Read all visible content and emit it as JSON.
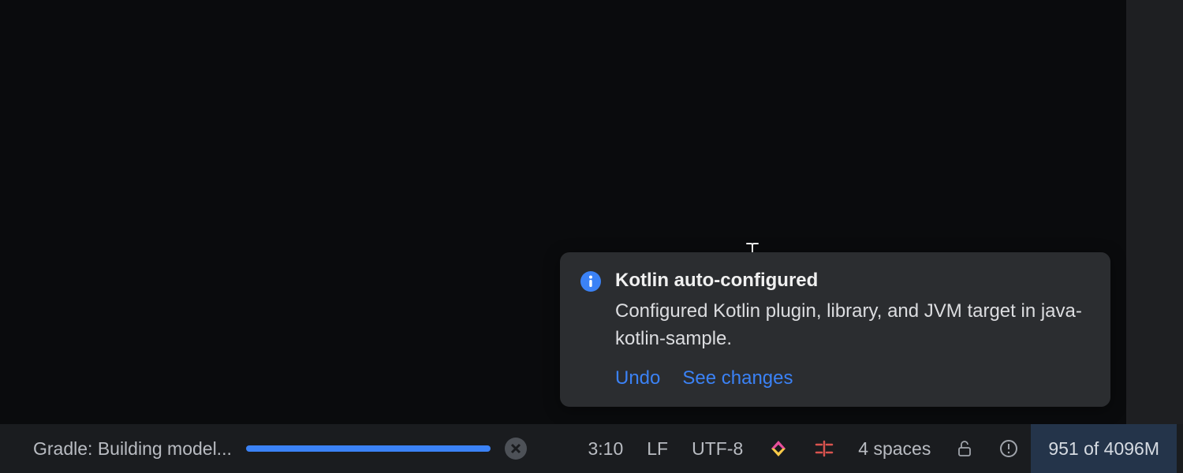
{
  "notification": {
    "icon": "info-icon",
    "title": "Kotlin auto-configured",
    "message": "Configured Kotlin plugin, library, and JVM target in java-kotlin-sample.",
    "actions": {
      "undo": "Undo",
      "see_changes": "See changes"
    }
  },
  "status_bar": {
    "task_label": "Gradle: Building model...",
    "progress_percent": 100,
    "cancel_icon": "close-icon",
    "cursor_position": "3:10",
    "line_separator": "LF",
    "encoding": "UTF-8",
    "code_with_me_icon": "code-with-me-icon",
    "wrap_icon": "wrap-guide-icon",
    "indent": "4 spaces",
    "lock_icon": "lock-open-icon",
    "problems_icon": "problems-icon",
    "memory": "951 of 4096M"
  },
  "colors": {
    "accent": "#3b82f6",
    "toast_bg": "#2b2d30",
    "bg": "#0a0b0d",
    "status_bg": "#1a1c1f"
  }
}
